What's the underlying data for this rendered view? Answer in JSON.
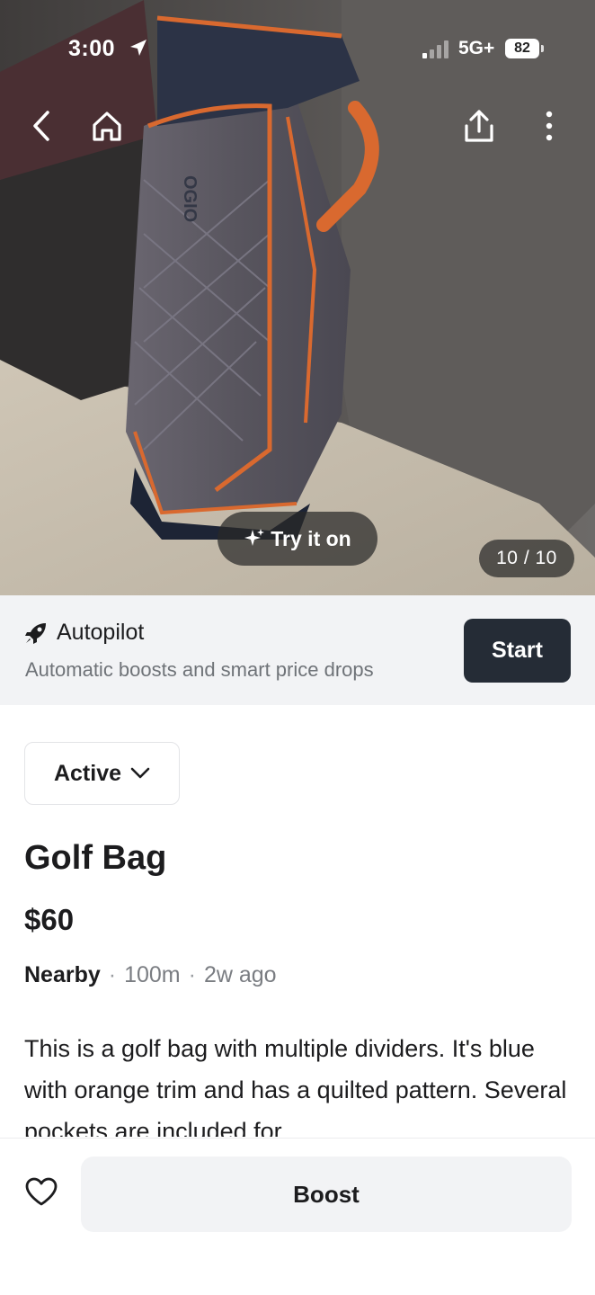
{
  "status_bar": {
    "time": "3:00",
    "network": "5G+",
    "battery": "82"
  },
  "photo": {
    "try_on_label": "Try it on",
    "counter": "10 / 10",
    "subject": "golf-bag-photo",
    "brand_print": "OGIO"
  },
  "nav": {
    "back_icon": "chevron-left-icon",
    "home_icon": "home-icon",
    "share_icon": "share-icon",
    "more_icon": "more-vertical-icon"
  },
  "autopilot": {
    "title": "Autopilot",
    "subtitle": "Automatic boosts and smart price drops",
    "start_label": "Start",
    "icon": "rocket-icon"
  },
  "listing": {
    "status": "Active",
    "title": "Golf Bag",
    "price": "$60",
    "location": "Nearby",
    "distance": "100m",
    "age": "2w ago",
    "description": "This is a golf bag with multiple dividers. It's blue with orange trim and has a quilted pattern. Several pockets are included for"
  },
  "bottom_bar": {
    "boost_label": "Boost",
    "heart_icon": "heart-icon"
  },
  "colors": {
    "start_button": "#252c36",
    "panel_bg": "#f2f3f5",
    "bag_trim": "#d9692f",
    "bag_body": "#5a5c66"
  }
}
